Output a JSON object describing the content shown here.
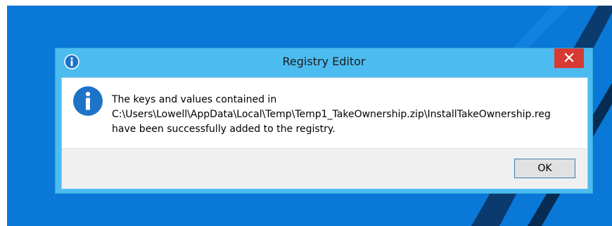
{
  "dialog": {
    "title": "Registry Editor",
    "title_icon": "info-icon",
    "close_icon": "close-icon",
    "message_icon": "info-icon",
    "message_lines": [
      "The keys and values contained in",
      "C:\\Users\\Lowell\\AppData\\Local\\Temp\\Temp1_TakeOwnership.zip\\InstallTakeOwnership.reg",
      "have been successfully added to the registry."
    ],
    "ok_label": "OK"
  },
  "colors": {
    "desktop": "#0a78d6",
    "titlebar": "#4cbcf0",
    "close_button": "#d63b33",
    "info_icon": "#1d73c7"
  }
}
